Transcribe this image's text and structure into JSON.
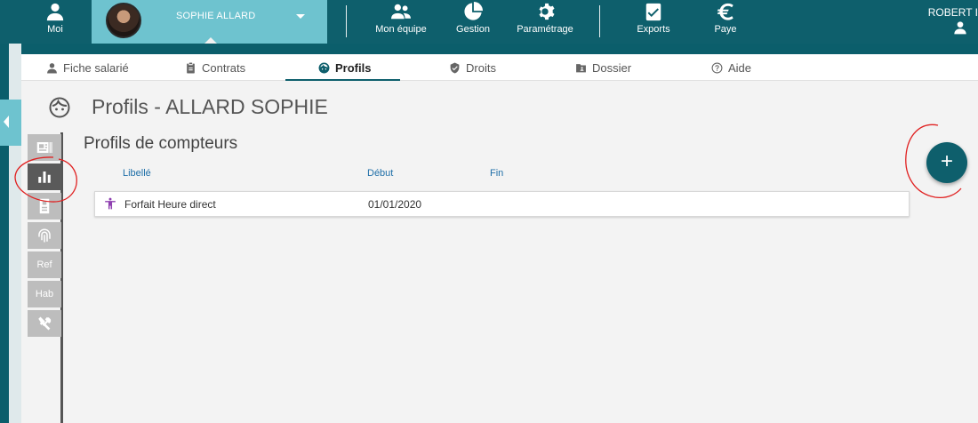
{
  "topbar": {
    "moi": "Moi",
    "user_name": "SOPHIE ALLARD",
    "mon_equipe": "Mon équipe",
    "gestion": "Gestion",
    "parametrage": "Paramétrage",
    "exports": "Exports",
    "paye": "Paye",
    "account_name": "ROBERT I"
  },
  "tabs": [
    {
      "label": "Fiche salarié",
      "icon": "person-icon"
    },
    {
      "label": "Contrats",
      "icon": "clipboard-icon"
    },
    {
      "label": "Profils",
      "icon": "face-icon"
    },
    {
      "label": "Droits",
      "icon": "shield-icon"
    },
    {
      "label": "Dossier",
      "icon": "folder-icon"
    },
    {
      "label": "Aide",
      "icon": "help-icon"
    }
  ],
  "active_tab": "Profils",
  "page": {
    "title": "Profils - ALLARD SOPHIE",
    "section_title": "Profils de compteurs"
  },
  "side_toolbar": [
    {
      "icon": "id-card-icon",
      "label": ""
    },
    {
      "icon": "bar-chart-icon",
      "label": ""
    },
    {
      "icon": "badge-icon",
      "label": ""
    },
    {
      "icon": "fingerprint-icon",
      "label": ""
    },
    {
      "icon": "",
      "label": "Ref"
    },
    {
      "icon": "",
      "label": "Hab"
    },
    {
      "icon": "tools-icon",
      "label": ""
    }
  ],
  "table": {
    "columns": [
      "Libellé",
      "Début",
      "Fin"
    ],
    "rows": [
      {
        "libelle": "Forfait Heure direct",
        "debut": "01/01/2020",
        "fin": ""
      }
    ]
  },
  "fab_label": "+",
  "colors": {
    "primary": "#0e5f6c",
    "user_tab": "#6ec3cf",
    "row_icon": "#8e3fb0",
    "annotation": "#e02020"
  }
}
